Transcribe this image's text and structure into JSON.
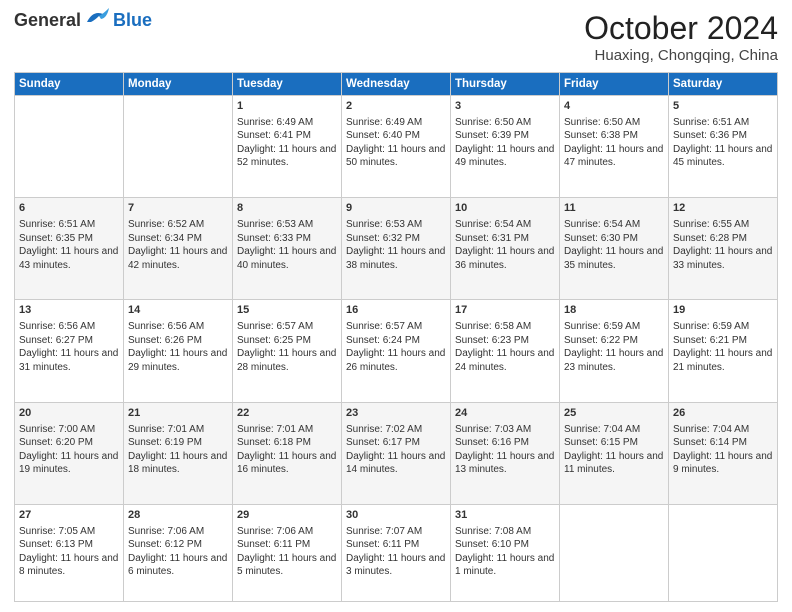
{
  "header": {
    "logo_general": "General",
    "logo_blue": "Blue",
    "month_title": "October 2024",
    "location": "Huaxing, Chongqing, China"
  },
  "weekdays": [
    "Sunday",
    "Monday",
    "Tuesday",
    "Wednesday",
    "Thursday",
    "Friday",
    "Saturday"
  ],
  "weeks": [
    [
      {
        "day": "",
        "info": ""
      },
      {
        "day": "",
        "info": ""
      },
      {
        "day": "1",
        "info": "Sunrise: 6:49 AM\nSunset: 6:41 PM\nDaylight: 11 hours and 52 minutes."
      },
      {
        "day": "2",
        "info": "Sunrise: 6:49 AM\nSunset: 6:40 PM\nDaylight: 11 hours and 50 minutes."
      },
      {
        "day": "3",
        "info": "Sunrise: 6:50 AM\nSunset: 6:39 PM\nDaylight: 11 hours and 49 minutes."
      },
      {
        "day": "4",
        "info": "Sunrise: 6:50 AM\nSunset: 6:38 PM\nDaylight: 11 hours and 47 minutes."
      },
      {
        "day": "5",
        "info": "Sunrise: 6:51 AM\nSunset: 6:36 PM\nDaylight: 11 hours and 45 minutes."
      }
    ],
    [
      {
        "day": "6",
        "info": "Sunrise: 6:51 AM\nSunset: 6:35 PM\nDaylight: 11 hours and 43 minutes."
      },
      {
        "day": "7",
        "info": "Sunrise: 6:52 AM\nSunset: 6:34 PM\nDaylight: 11 hours and 42 minutes."
      },
      {
        "day": "8",
        "info": "Sunrise: 6:53 AM\nSunset: 6:33 PM\nDaylight: 11 hours and 40 minutes."
      },
      {
        "day": "9",
        "info": "Sunrise: 6:53 AM\nSunset: 6:32 PM\nDaylight: 11 hours and 38 minutes."
      },
      {
        "day": "10",
        "info": "Sunrise: 6:54 AM\nSunset: 6:31 PM\nDaylight: 11 hours and 36 minutes."
      },
      {
        "day": "11",
        "info": "Sunrise: 6:54 AM\nSunset: 6:30 PM\nDaylight: 11 hours and 35 minutes."
      },
      {
        "day": "12",
        "info": "Sunrise: 6:55 AM\nSunset: 6:28 PM\nDaylight: 11 hours and 33 minutes."
      }
    ],
    [
      {
        "day": "13",
        "info": "Sunrise: 6:56 AM\nSunset: 6:27 PM\nDaylight: 11 hours and 31 minutes."
      },
      {
        "day": "14",
        "info": "Sunrise: 6:56 AM\nSunset: 6:26 PM\nDaylight: 11 hours and 29 minutes."
      },
      {
        "day": "15",
        "info": "Sunrise: 6:57 AM\nSunset: 6:25 PM\nDaylight: 11 hours and 28 minutes."
      },
      {
        "day": "16",
        "info": "Sunrise: 6:57 AM\nSunset: 6:24 PM\nDaylight: 11 hours and 26 minutes."
      },
      {
        "day": "17",
        "info": "Sunrise: 6:58 AM\nSunset: 6:23 PM\nDaylight: 11 hours and 24 minutes."
      },
      {
        "day": "18",
        "info": "Sunrise: 6:59 AM\nSunset: 6:22 PM\nDaylight: 11 hours and 23 minutes."
      },
      {
        "day": "19",
        "info": "Sunrise: 6:59 AM\nSunset: 6:21 PM\nDaylight: 11 hours and 21 minutes."
      }
    ],
    [
      {
        "day": "20",
        "info": "Sunrise: 7:00 AM\nSunset: 6:20 PM\nDaylight: 11 hours and 19 minutes."
      },
      {
        "day": "21",
        "info": "Sunrise: 7:01 AM\nSunset: 6:19 PM\nDaylight: 11 hours and 18 minutes."
      },
      {
        "day": "22",
        "info": "Sunrise: 7:01 AM\nSunset: 6:18 PM\nDaylight: 11 hours and 16 minutes."
      },
      {
        "day": "23",
        "info": "Sunrise: 7:02 AM\nSunset: 6:17 PM\nDaylight: 11 hours and 14 minutes."
      },
      {
        "day": "24",
        "info": "Sunrise: 7:03 AM\nSunset: 6:16 PM\nDaylight: 11 hours and 13 minutes."
      },
      {
        "day": "25",
        "info": "Sunrise: 7:04 AM\nSunset: 6:15 PM\nDaylight: 11 hours and 11 minutes."
      },
      {
        "day": "26",
        "info": "Sunrise: 7:04 AM\nSunset: 6:14 PM\nDaylight: 11 hours and 9 minutes."
      }
    ],
    [
      {
        "day": "27",
        "info": "Sunrise: 7:05 AM\nSunset: 6:13 PM\nDaylight: 11 hours and 8 minutes."
      },
      {
        "day": "28",
        "info": "Sunrise: 7:06 AM\nSunset: 6:12 PM\nDaylight: 11 hours and 6 minutes."
      },
      {
        "day": "29",
        "info": "Sunrise: 7:06 AM\nSunset: 6:11 PM\nDaylight: 11 hours and 5 minutes."
      },
      {
        "day": "30",
        "info": "Sunrise: 7:07 AM\nSunset: 6:11 PM\nDaylight: 11 hours and 3 minutes."
      },
      {
        "day": "31",
        "info": "Sunrise: 7:08 AM\nSunset: 6:10 PM\nDaylight: 11 hours and 1 minute."
      },
      {
        "day": "",
        "info": ""
      },
      {
        "day": "",
        "info": ""
      }
    ]
  ]
}
